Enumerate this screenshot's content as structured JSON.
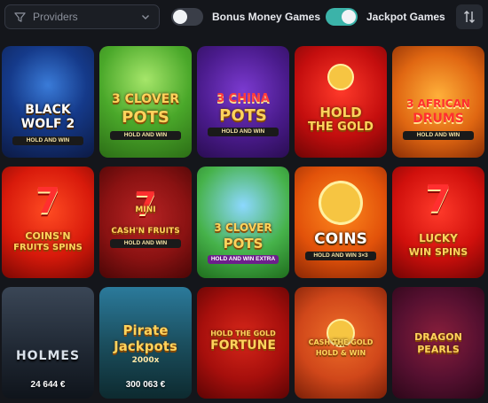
{
  "filter": {
    "providers_placeholder": "Providers"
  },
  "toggles": [
    {
      "label": "Bonus Money Games",
      "state": "off"
    },
    {
      "label": "Jackpot Games",
      "state": "on"
    }
  ],
  "colors": {
    "accent": "#3bb3a9",
    "background": "#14161b"
  },
  "games": [
    {
      "line1": "BLACK",
      "line2": "WOLF 2",
      "sub": "HOLD AND WIN"
    },
    {
      "line1": "3 CLOVER",
      "line2": "POTS",
      "sub": "HOLD AND WIN"
    },
    {
      "line1": "3 CHINA",
      "line2": "POTS",
      "sub": "HOLD AND WIN"
    },
    {
      "line1": "HOLD",
      "line2": "THE GOLD",
      "sub": ""
    },
    {
      "line1": "3 AFRICAN",
      "line2": "DRUMS",
      "sub": "HOLD AND WIN"
    },
    {
      "line1": "COINS'N",
      "line2": "FRUITS SPINS",
      "sub": ""
    },
    {
      "line1": "MINI",
      "line2": "CASH'N FRUITS",
      "sub": "HOLD AND WIN"
    },
    {
      "line1": "3 CLOVER",
      "line2": "POTS",
      "sub": "HOLD AND WIN EXTRA"
    },
    {
      "line1": "COINS",
      "line2": "",
      "sub": "HOLD AND WIN 3×3"
    },
    {
      "line1": "LUCKY",
      "line2": "WIN SPINS",
      "sub": ""
    },
    {
      "line1": "HOLMES",
      "line2": "",
      "sub": "",
      "amount": "24 644 €"
    },
    {
      "line1": "Pirate",
      "line2": "Jackpots",
      "sub": "2000x",
      "amount": "300 063 €"
    },
    {
      "line1": "HOLD THE GOLD",
      "line2": "FORTUNE",
      "sub": ""
    },
    {
      "line1": "CASH THE GOLD",
      "line2": "HOLD & WIN",
      "sub": ""
    },
    {
      "line1": "DRAGON",
      "line2": "PEARLS",
      "sub": ""
    }
  ]
}
